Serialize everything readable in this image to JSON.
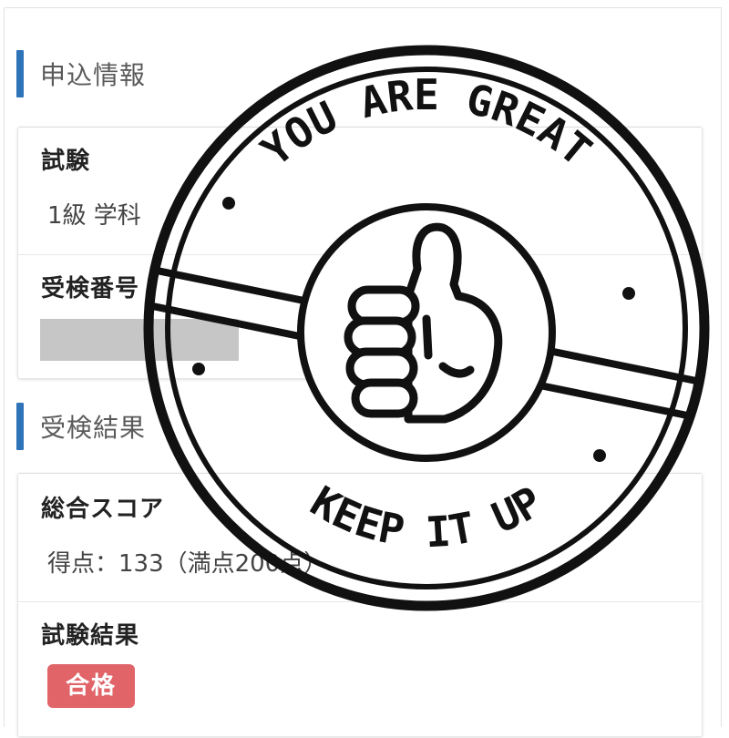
{
  "application_section": {
    "title": "申込情報",
    "exam_label": "試験",
    "exam_value": "1級 学科",
    "exam_number_label": "受検番号"
  },
  "result_section": {
    "title": "受検結果",
    "total_score_label": "総合スコア",
    "score_text": "得点：133（満点200点）",
    "exam_result_label": "試験結果",
    "result_badge": "合格"
  },
  "stamp": {
    "top_text": "YOU ARE GREAT",
    "bottom_text": "KEEP IT UP",
    "icon": "thumbs-up-icon"
  },
  "colors": {
    "accent_bar": "#2f73b8",
    "pass_badge": "#e06468",
    "stamp_ink": "#111111"
  }
}
